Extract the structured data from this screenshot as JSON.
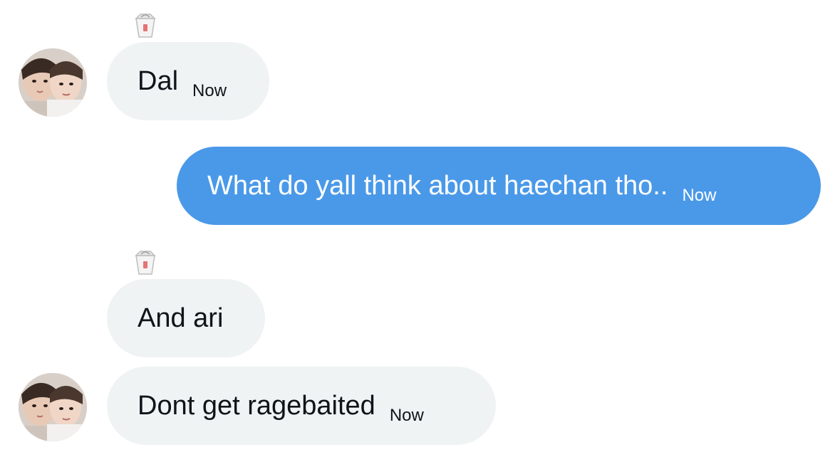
{
  "conversation": {
    "messages": [
      {
        "sender": "other",
        "text": "Dal",
        "time": "Now",
        "reaction_icon": "takeout-box-icon",
        "has_avatar": true
      },
      {
        "sender": "me",
        "text": "What do yall think about haechan tho..",
        "time": "Now"
      },
      {
        "sender": "other",
        "text": "And ari",
        "time": "",
        "reaction_icon": "takeout-box-icon",
        "has_avatar": false
      },
      {
        "sender": "other",
        "text": "Dont get ragebaited",
        "time": "Now",
        "has_avatar": true
      }
    ]
  },
  "colors": {
    "received_bubble": "#eff3f4",
    "sent_bubble": "#4a99e9",
    "received_text": "#0f1419",
    "sent_text": "#ffffff"
  }
}
